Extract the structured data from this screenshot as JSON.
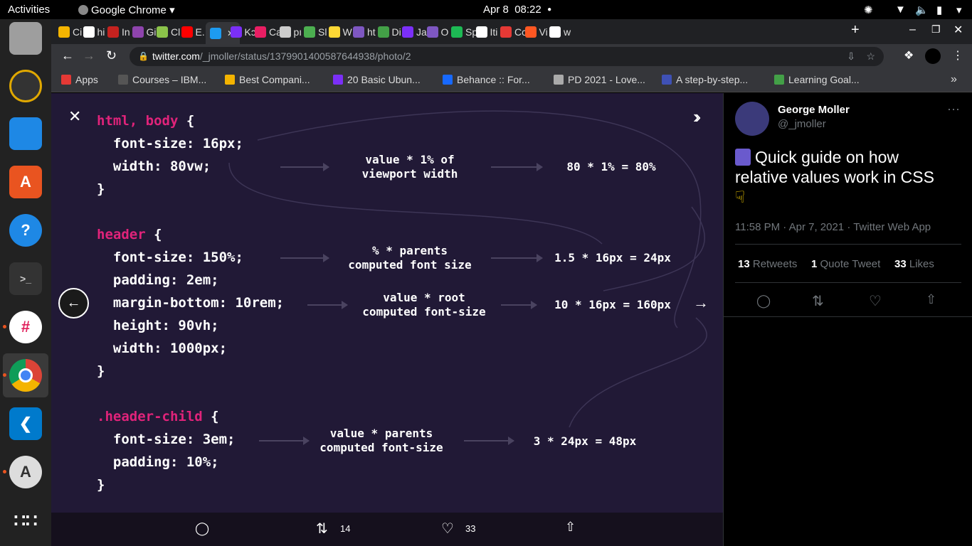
{
  "topbar": {
    "activities": "Activities",
    "app_name": "Google Chrome",
    "date": "Apr 8",
    "time": "08:22"
  },
  "tabs": [
    {
      "label": "Ci",
      "color": "#f4b400"
    },
    {
      "label": "hi",
      "color": "#ffffff"
    },
    {
      "label": "In",
      "color": "#c5221f"
    },
    {
      "label": "Gi",
      "color": "#8e44ad"
    },
    {
      "label": "Cl",
      "color": "#8bc34a"
    },
    {
      "label": "E.",
      "color": "#ff0000"
    },
    {
      "label": "",
      "color": "#1d9bf0"
    },
    {
      "label": "Kɔ",
      "color": "#7b2ff7"
    },
    {
      "label": "Ca",
      "color": "#e91e63"
    },
    {
      "label": "pı",
      "color": "#cccccc"
    },
    {
      "label": "Sl",
      "color": "#4caf50"
    },
    {
      "label": "W",
      "color": "#fdd835"
    },
    {
      "label": "ht",
      "color": "#7e57c2"
    },
    {
      "label": "Di",
      "color": "#43a047"
    },
    {
      "label": "Ja",
      "color": "#7b2ff7"
    },
    {
      "label": "O",
      "color": "#7e57c2"
    },
    {
      "label": "Sp",
      "color": "#1db954"
    },
    {
      "label": "Iti",
      "color": "#ffffff"
    },
    {
      "label": "Cc",
      "color": "#e53935"
    },
    {
      "label": "Vi",
      "color": "#ff5722"
    },
    {
      "label": "w",
      "color": "#ffffff"
    }
  ],
  "address": {
    "host": "twitter.com",
    "path": "/_jmoller/status/1379901400587644938/photo/2"
  },
  "bookmarks": [
    {
      "label": "Apps",
      "color": "#e53935"
    },
    {
      "label": "Courses – IBM...",
      "color": "#555555"
    },
    {
      "label": "Best Compani...",
      "color": "#f4b400"
    },
    {
      "label": "20 Basic Ubun...",
      "color": "#7b2ff7"
    },
    {
      "label": "Behance :: For...",
      "color": "#1769ff"
    },
    {
      "label": "PD 2021 - Love...",
      "color": "#aaaaaa"
    },
    {
      "label": "A step-by-step...",
      "color": "#3f51b5"
    },
    {
      "label": "Learning Goal...",
      "color": "#43a047"
    }
  ],
  "slide": {
    "b1": {
      "selector": "html, body",
      "open": " {",
      "l1": "  font-size: 16px;",
      "l2": "  width: 80vw;",
      "close": "}"
    },
    "b2": {
      "selector": "header",
      "open": " {",
      "l1": "  font-size: 150%;",
      "l2": "  padding: 2em;",
      "l3": "  margin-bottom: 10rem;",
      "l4": "  height: 90vh;",
      "l5": "  width: 1000px;",
      "close": "}"
    },
    "b3": {
      "selector": ".header-child",
      "open": " {",
      "l1": "  font-size: 3em;",
      "l2": "  padding: 10%;",
      "close": "}"
    },
    "n1a": "value * 1% of",
    "n1b": "viewport width",
    "r1": "80 * 1% = 80%",
    "n2a": "% * parents",
    "n2b": "computed font size",
    "r2": "1.5 * 16px = 24px",
    "n3a": "value * root",
    "n3b": "computed font-size",
    "r3": "10 * 16px = 160px",
    "n4a": "value * parents",
    "n4b": "computed font-size",
    "r4": "3 * 24px = 48px"
  },
  "viewer_actions": {
    "retweets": "14",
    "likes": "33"
  },
  "tweet": {
    "name": "George Moller",
    "handle": "@_jmoller",
    "text": "Quick guide on how relative values work in CSS",
    "meta": "11:58 PM · Apr 7, 2021 · Twitter Web App",
    "retweets_count": "13",
    "retweets_label": "Retweets",
    "quote_count": "1",
    "quote_label": "Quote Tweet",
    "likes_count": "33",
    "likes_label": "Likes"
  },
  "icons": [
    "more-icon",
    "close-icon",
    "expand-icon",
    "arrow-left-icon",
    "arrow-right-icon",
    "reply-icon",
    "retweet-icon",
    "like-icon",
    "share-icon"
  ]
}
